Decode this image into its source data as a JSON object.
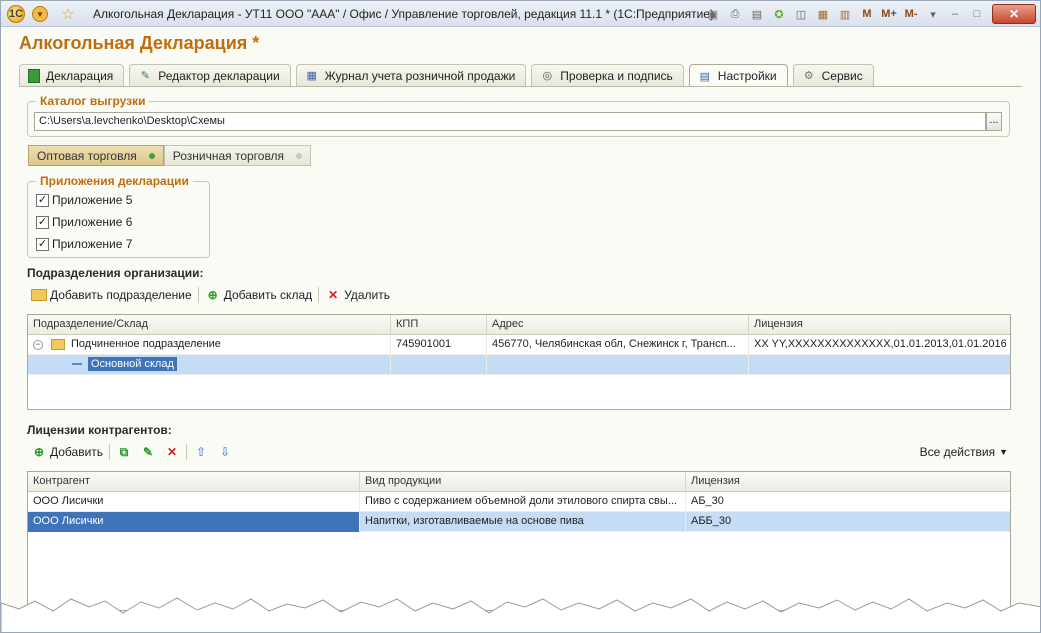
{
  "window": {
    "title": "Алкогольная Декларация - УТ11 ООО \"ААА\" / Офис / Управление торговлей, редакция 11.1 * (1С:Предприятие)",
    "logo_text": "1С",
    "tools": {
      "m": "M",
      "m_plus": "M+",
      "m_minus": "M-"
    }
  },
  "page": {
    "title": "Алкогольная Декларация *"
  },
  "tabs": [
    {
      "label": "Декларация",
      "icon": "document-icon",
      "active": false
    },
    {
      "label": "Редактор декларации",
      "icon": "edit-document-icon",
      "active": false
    },
    {
      "label": "Журнал учета розничной продажи",
      "icon": "journal-icon",
      "active": false
    },
    {
      "label": "Проверка и подпись",
      "icon": "check-icon",
      "active": false
    },
    {
      "label": "Настройки",
      "icon": "settings-list-icon",
      "active": true
    },
    {
      "label": "Сервис",
      "icon": "gear-icon",
      "active": false
    }
  ],
  "export_catalog": {
    "label": "Каталог выгрузки",
    "path": "C:\\Users\\a.levchenko\\Desktop\\Схемы",
    "browse_label": "..."
  },
  "trade_switch": {
    "wholesale": "Оптовая торговля",
    "retail": "Розничная торговля",
    "selected": "wholesale"
  },
  "appendices": {
    "label": "Приложения декларации",
    "items": [
      {
        "label": "Приложение 5",
        "checked": true
      },
      {
        "label": "Приложение 6",
        "checked": true
      },
      {
        "label": "Приложение 7",
        "checked": true
      }
    ],
    "check_mark": "✓"
  },
  "divisions": {
    "label": "Подразделения организации:",
    "toolbar": {
      "add_division": "Добавить подразделение",
      "add_warehouse": "Добавить склад",
      "delete": "Удалить"
    },
    "columns": [
      "Подразделение/Склад",
      "КПП",
      "Адрес",
      "Лицензия"
    ],
    "rows": [
      {
        "name": "Подчиненное подразделение",
        "kpp": "745901001",
        "address": "456770, Челябинская обл, Снежинск г, Трансп...",
        "license": "XX YY,XXXXXXXXXXXXXX,01.01.2013,01.01.2016"
      },
      {
        "name": "Основной склад",
        "kpp": "",
        "address": "",
        "license": ""
      }
    ]
  },
  "licenses": {
    "label": "Лицензии контрагентов:",
    "toolbar": {
      "add": "Добавить",
      "all_actions": "Все действия"
    },
    "columns": [
      "Контрагент",
      "Вид продукции",
      "Лицензия"
    ],
    "rows": [
      {
        "counterparty": "ООО Лисички",
        "product": "Пиво с содержанием объемной доли этилового спирта свы...",
        "license": "АБ_30"
      },
      {
        "counterparty": "ООО Лисички",
        "product": "Напитки, изготавливаемые на основе пива",
        "license": "АББ_30"
      }
    ]
  },
  "colors": {
    "accent_orange": "#c06d10",
    "selection_row": "#c4dcf4",
    "selection_cell": "#3f74b8"
  }
}
